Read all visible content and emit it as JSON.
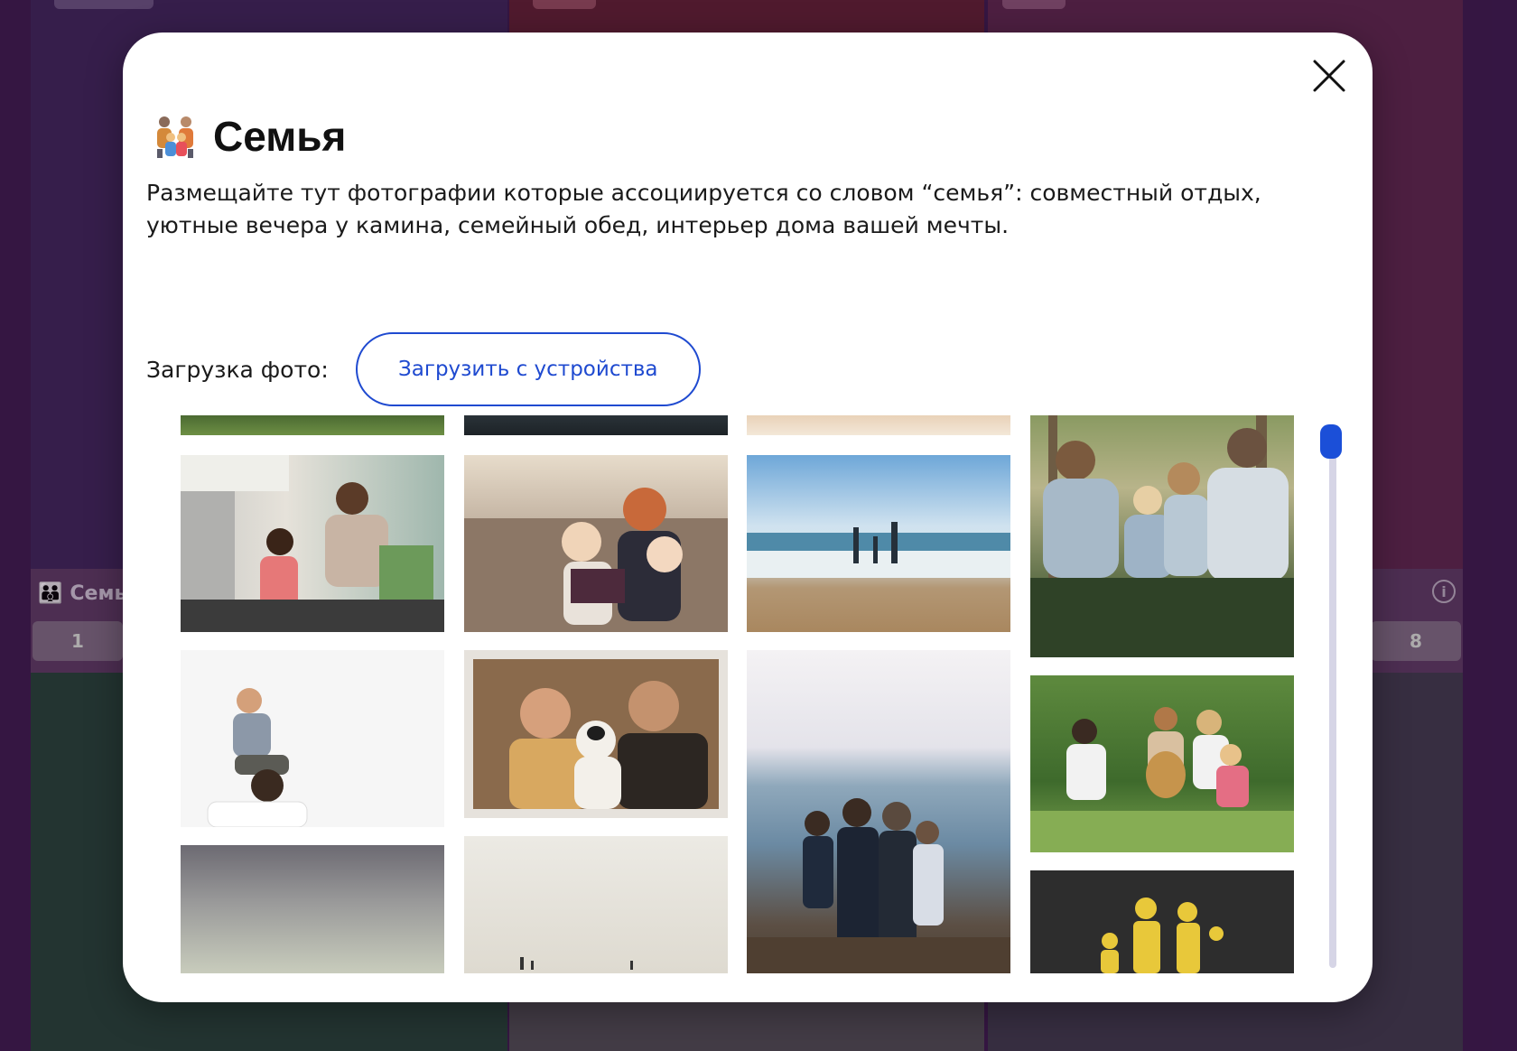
{
  "background": {
    "section_title": "Семь",
    "number_boxes": [
      "1",
      "8"
    ],
    "info_icon": "info-icon"
  },
  "modal": {
    "title": "Семья",
    "title_icon": "family-icon",
    "description": "Размещайте тут фотографии которые ассоциируется со словом “семья”: совместный отдых, уютные вечера у камина, семейный обед, интерьер дома вашей мечты.",
    "upload_label": "Загрузка фото:",
    "upload_button": "Загрузить с устройства",
    "close_icon": "close-icon"
  },
  "gallery": {
    "photos": [
      "grass-strip",
      "dark-water-strip",
      "beach-sand-strip",
      "father-daughter-kitchen",
      "mother-children-sofa",
      "family-beach-walk",
      "family-in-forest",
      "child-on-shoulders",
      "couple-with-dog",
      "family-hugging-sea",
      "family-with-dog-park",
      "gray-sky",
      "beach-people-sky",
      "road-family-sign"
    ]
  },
  "colors": {
    "accent": "#1f4ad0",
    "scroll_thumb": "#1b4fd8",
    "modal_bg": "#ffffff"
  }
}
